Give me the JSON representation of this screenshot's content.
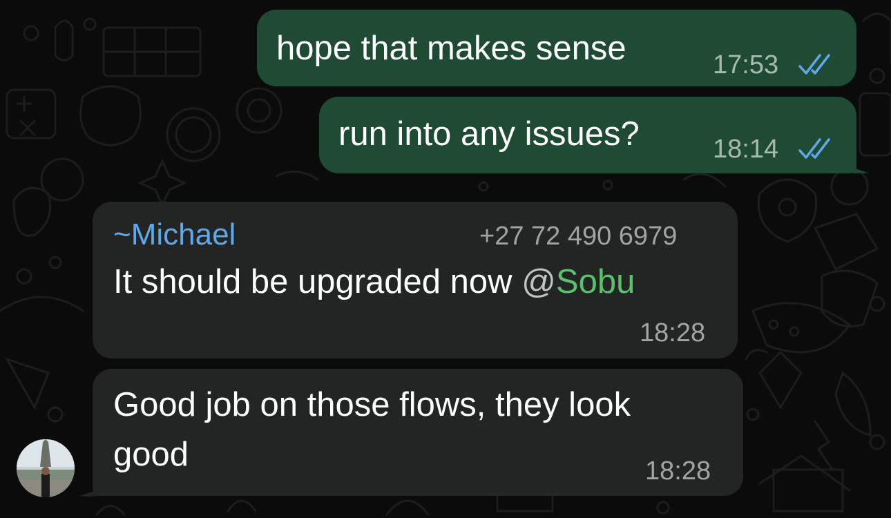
{
  "colors": {
    "outgoing_bubble": "#1f4a34",
    "incoming_bubble": "#222524",
    "sender_name": "#5fa8ea",
    "mention": "#59c26b",
    "read_ticks": "#5fa8ea",
    "background": "#0b0b0b"
  },
  "messages": [
    {
      "direction": "outgoing",
      "text": "hope that makes sense",
      "time": "17:53",
      "status_icon": "double-check-read-icon"
    },
    {
      "direction": "outgoing",
      "text": "run into any issues?",
      "time": "18:14",
      "status_icon": "double-check-read-icon"
    },
    {
      "direction": "incoming",
      "sender_prefix": "~",
      "sender_name": "Michael",
      "sender_phone": "+27 72 490 6979",
      "text": "It should be upgraded now ",
      "mention_at": "@",
      "mention_name": "Sobu",
      "time": "18:28"
    },
    {
      "direction": "incoming",
      "text_line1": "Good job on those flows, they look",
      "text_line2": "good",
      "time": "18:28",
      "avatar_icon": "contact-avatar"
    }
  ]
}
